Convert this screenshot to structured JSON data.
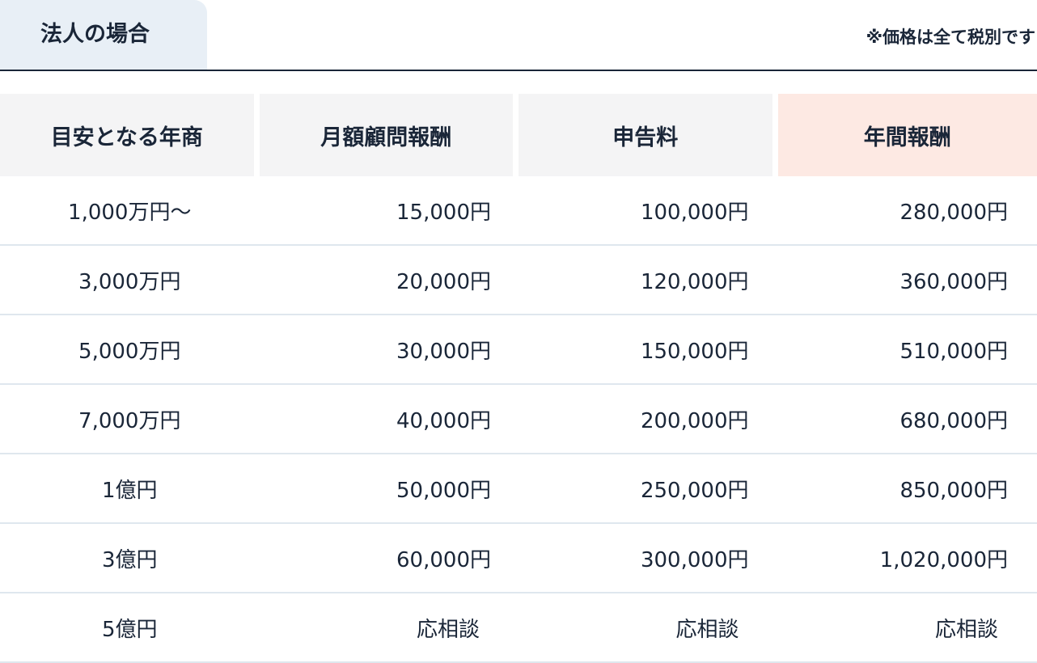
{
  "tab": {
    "label": "法人の場合"
  },
  "note": "※価格は全て税別です",
  "table": {
    "headers": [
      "目安となる年商",
      "月額顧問報酬",
      "申告料",
      "年間報酬"
    ],
    "rows": [
      [
        "1,000万円～",
        "15,000円",
        "100,000円",
        "280,000円"
      ],
      [
        "3,000万円",
        "20,000円",
        "120,000円",
        "360,000円"
      ],
      [
        "5,000万円",
        "30,000円",
        "150,000円",
        "510,000円"
      ],
      [
        "7,000万円",
        "40,000円",
        "200,000円",
        "680,000円"
      ],
      [
        "1億円",
        "50,000円",
        "250,000円",
        "850,000円"
      ],
      [
        "3億円",
        "60,000円",
        "300,000円",
        "1,020,000円"
      ],
      [
        "5億円",
        "応相談",
        "応相談",
        "応相談"
      ]
    ]
  },
  "colors": {
    "text": "#1a2638",
    "tab_bg": "#e8eff6",
    "header_bg": "#f4f4f5",
    "highlight_header_bg": "#fde9e3",
    "row_divider": "#dfe7ee"
  }
}
